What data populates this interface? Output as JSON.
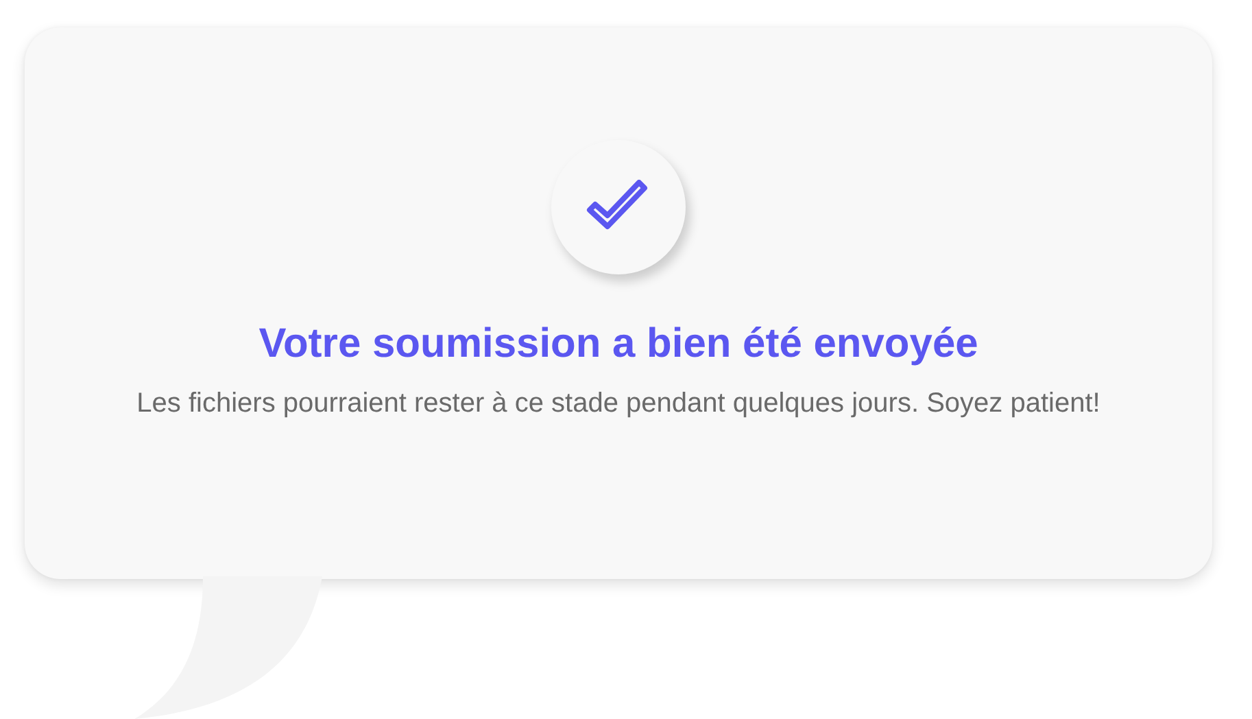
{
  "message": {
    "title": "Votre soumission a bien été envoyée",
    "body": "Les fichiers pourraient rester à ce stade pendant quelques jours. Soyez patient!"
  }
}
